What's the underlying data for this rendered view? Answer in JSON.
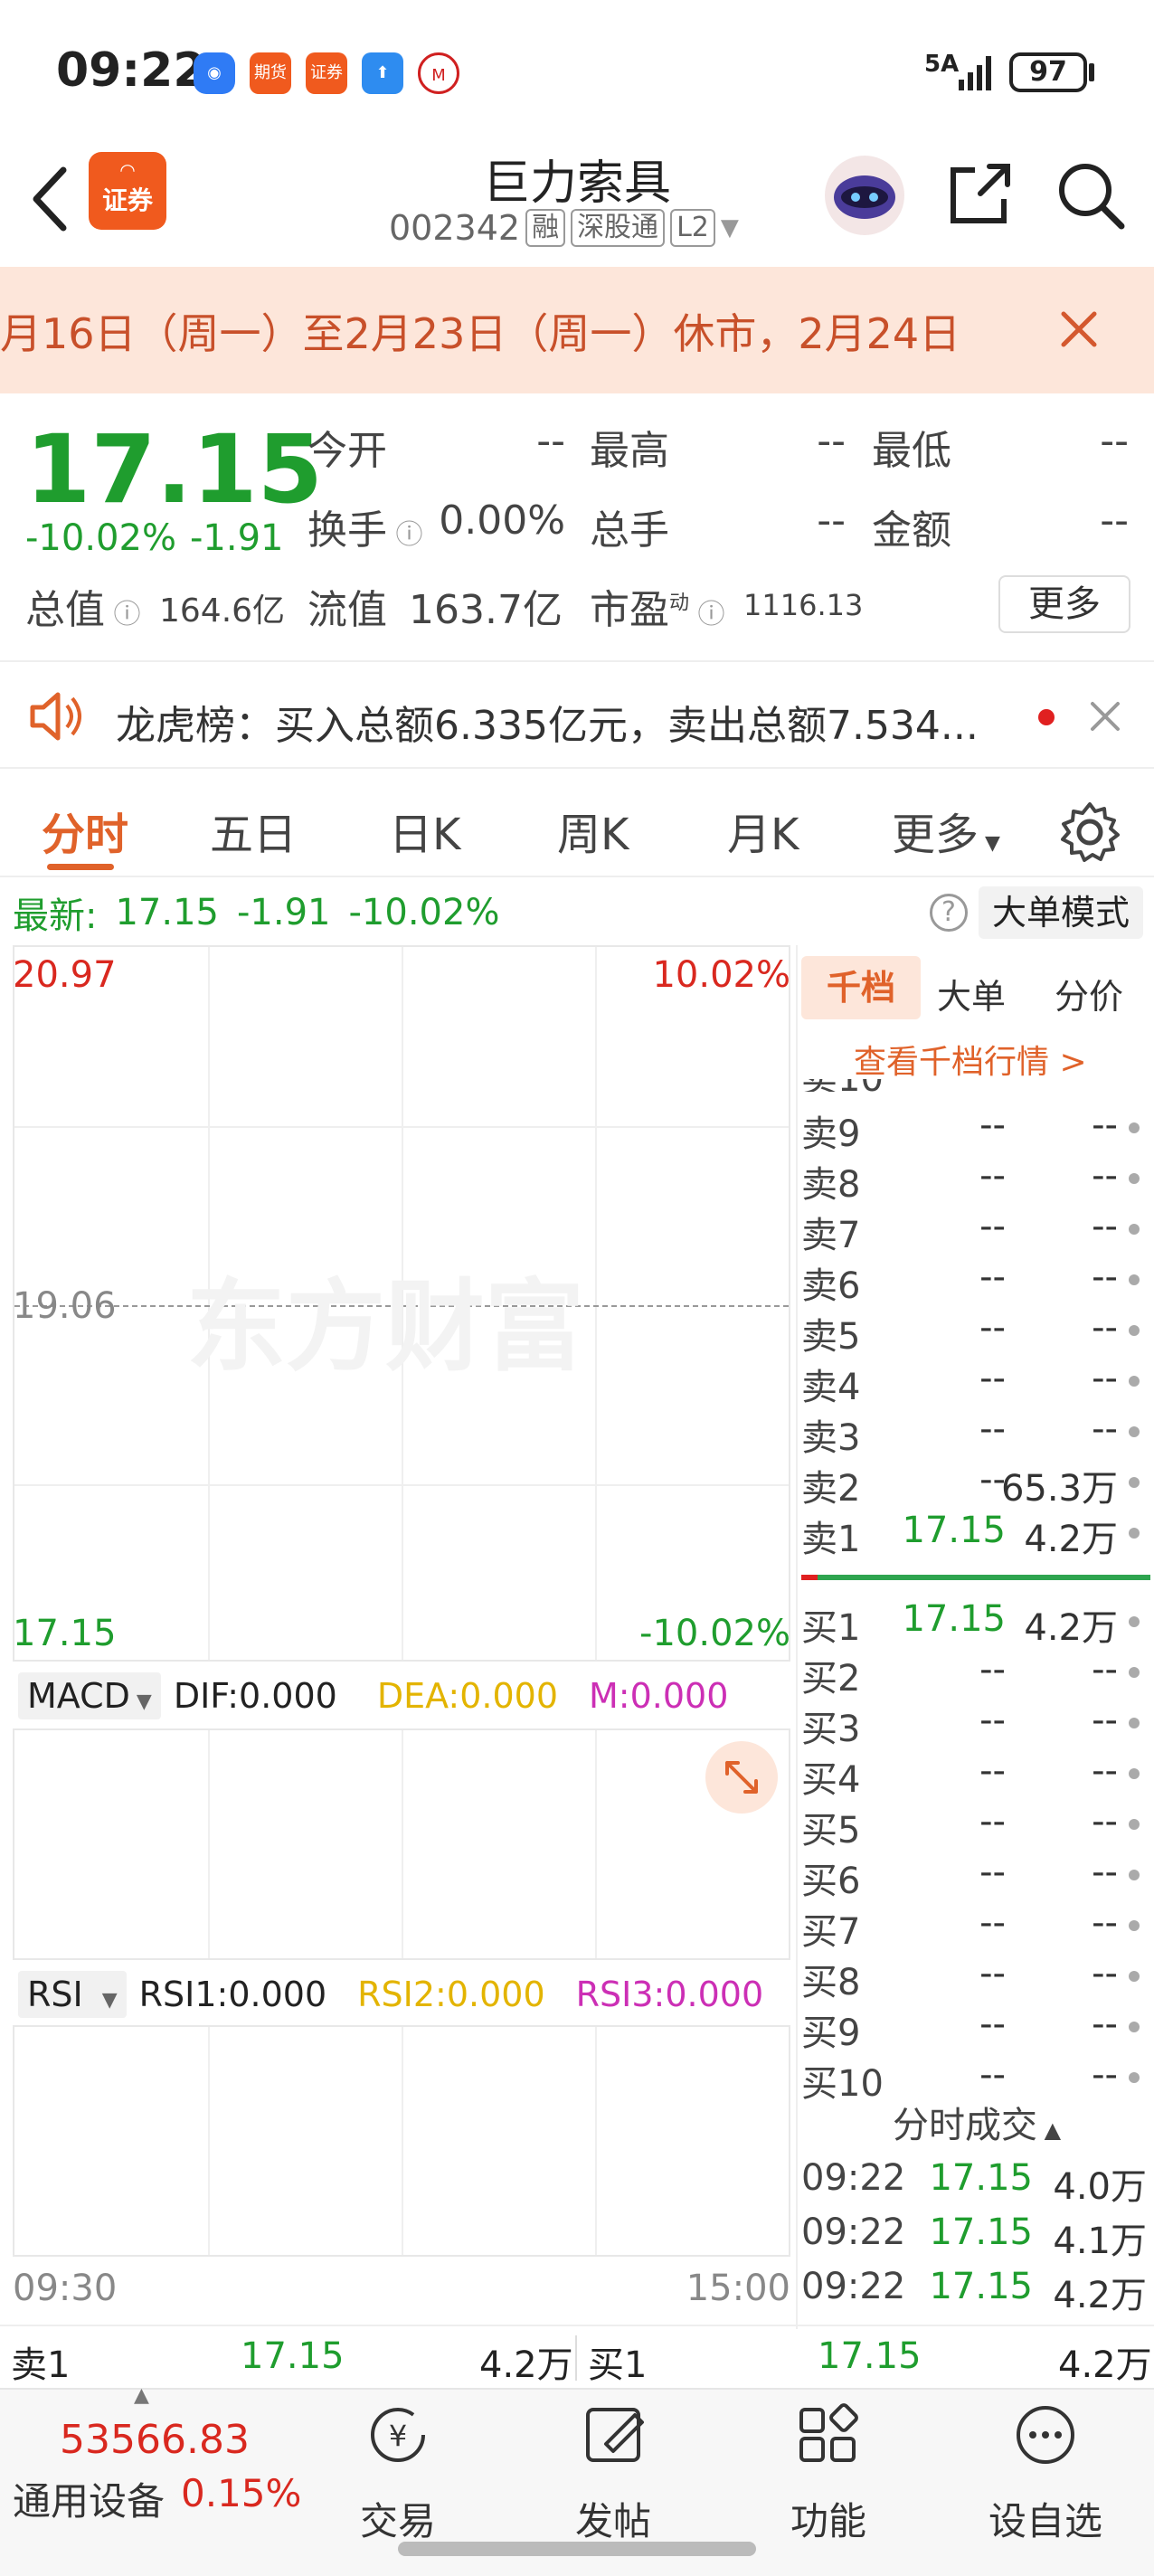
{
  "status_bar": {
    "time": "09:22",
    "network": "5A",
    "battery": "97",
    "app_icons": [
      "chat-app",
      "futures-app",
      "securities-app",
      "upload-app",
      "bank-app"
    ],
    "futures_label": "期货",
    "securities_label": "证券"
  },
  "header": {
    "stock_name": "巨力索具",
    "stock_code": "002342",
    "tags": [
      "融",
      "深股通",
      "L2"
    ],
    "app_badge": "证券"
  },
  "notice": {
    "text": "月16日（周一）至2月23日（周一）休市，2月24日"
  },
  "quote": {
    "price": "17.15",
    "change_pct": "-10.02%",
    "change_amt": "-1.91",
    "open_label": "今开",
    "open_value": "--",
    "high_label": "最高",
    "high_value": "--",
    "low_label": "最低",
    "low_value": "--",
    "turnover_label": "换手",
    "turnover_value": "0.00%",
    "volume_label": "总手",
    "volume_value": "--",
    "amount_label": "金额",
    "amount_value": "--",
    "mktcap_label": "总值",
    "mktcap_value": "164.6亿",
    "float_label": "流值",
    "float_value": "163.7亿",
    "pe_label": "市盈",
    "pe_sup": "动",
    "pe_value": "1116.13",
    "more_button": "更多"
  },
  "dragon": {
    "text": "龙虎榜：买入总额6.335亿元，卖出总额7.534..."
  },
  "tabs": {
    "items": [
      "分时",
      "五日",
      "日K",
      "周K",
      "月K",
      "更多"
    ],
    "active": "分时"
  },
  "latest": {
    "label": "最新:",
    "price": "17.15",
    "change": "-1.91",
    "pct": "-10.02%",
    "mode_button": "大单模式"
  },
  "chart": {
    "y_top": "20.97",
    "y_mid": "19.06",
    "y_bottom": "17.15",
    "pct_top": "10.02%",
    "pct_bottom": "-10.02%",
    "watermark": "东方财富",
    "time_start": "09:30",
    "time_end": "15:00",
    "macd": {
      "selector": "MACD",
      "dif": "DIF:0.000",
      "dea": "DEA:0.000",
      "m": "M:0.000",
      "dea_color": "#e3b400",
      "m_color": "#cc2fb5"
    },
    "rsi": {
      "selector": "RSI",
      "rsi1": "RSI1:0.000",
      "rsi2": "RSI2:0.000",
      "rsi3": "RSI3:0.000"
    }
  },
  "book": {
    "tabs": [
      "千档",
      "大单",
      "分价"
    ],
    "link": "查看千档行情 >",
    "sell": [
      {
        "label": "卖9",
        "price": "--",
        "vol": "--"
      },
      {
        "label": "卖8",
        "price": "--",
        "vol": "--"
      },
      {
        "label": "卖7",
        "price": "--",
        "vol": "--"
      },
      {
        "label": "卖6",
        "price": "--",
        "vol": "--"
      },
      {
        "label": "卖5",
        "price": "--",
        "vol": "--"
      },
      {
        "label": "卖4",
        "price": "--",
        "vol": "--"
      },
      {
        "label": "卖3",
        "price": "--",
        "vol": "--"
      },
      {
        "label": "卖2",
        "price": "--",
        "vol": "65.3万"
      },
      {
        "label": "卖1",
        "price": "17.15",
        "vol": "4.2万"
      }
    ],
    "buy": [
      {
        "label": "买1",
        "price": "17.15",
        "vol": "4.2万"
      },
      {
        "label": "买2",
        "price": "--",
        "vol": "--"
      },
      {
        "label": "买3",
        "price": "--",
        "vol": "--"
      },
      {
        "label": "买4",
        "price": "--",
        "vol": "--"
      },
      {
        "label": "买5",
        "price": "--",
        "vol": "--"
      },
      {
        "label": "买6",
        "price": "--",
        "vol": "--"
      },
      {
        "label": "买7",
        "price": "--",
        "vol": "--"
      },
      {
        "label": "买8",
        "price": "--",
        "vol": "--"
      },
      {
        "label": "买9",
        "price": "--",
        "vol": "--"
      },
      {
        "label": "买10",
        "price": "--",
        "vol": "--"
      }
    ],
    "trades_title": "分时成交",
    "trades": [
      {
        "time": "09:22",
        "price": "17.15",
        "vol": "4.0万"
      },
      {
        "time": "09:22",
        "price": "17.15",
        "vol": "4.1万"
      },
      {
        "time": "09:22",
        "price": "17.15",
        "vol": "4.2万"
      }
    ]
  },
  "strip": {
    "left_label": "卖1",
    "left_price": "17.15",
    "left_vol": "4.2万",
    "right_label": "买1",
    "right_price": "17.15",
    "right_vol": "4.2万"
  },
  "bottom": {
    "index_value": "53566.83",
    "index_name": "通用设备",
    "index_pct": "0.15%",
    "nav": [
      {
        "label": "交易",
        "icon": "trade-icon"
      },
      {
        "label": "发帖",
        "icon": "post-icon"
      },
      {
        "label": "功能",
        "icon": "apps-icon"
      },
      {
        "label": "设自选",
        "icon": "more-icon"
      }
    ]
  }
}
